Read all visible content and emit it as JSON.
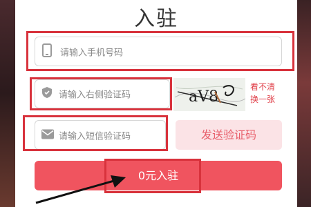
{
  "title": "入驻",
  "phone": {
    "placeholder": "请输入手机号码",
    "icon": "phone-icon"
  },
  "captcha_input": {
    "placeholder": "请输入右侧验证码",
    "icon": "shield-icon"
  },
  "captcha_image": {
    "text": "aV8"
  },
  "refresh_link": {
    "line1": "看不清",
    "line2": "换一张"
  },
  "sms_input": {
    "placeholder": "请输入短信验证码",
    "icon": "mail-icon"
  },
  "send_code_button": {
    "label": "发送验证码"
  },
  "submit_button": {
    "label": "0元入驻"
  },
  "colors": {
    "accent": "#f0545f",
    "highlight": "#d8323c",
    "link": "#e0404a"
  }
}
